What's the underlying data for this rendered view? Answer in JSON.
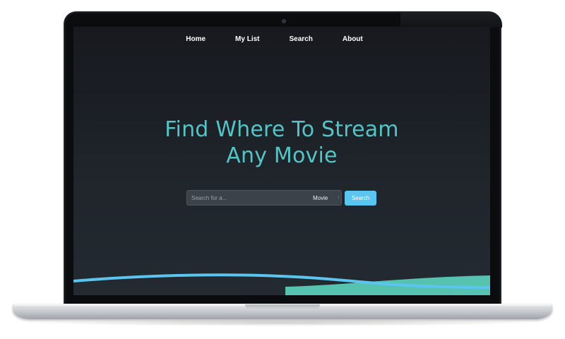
{
  "nav": {
    "items": [
      {
        "label": "Home"
      },
      {
        "label": "My List"
      },
      {
        "label": "Search"
      },
      {
        "label": "About"
      }
    ]
  },
  "hero": {
    "title_line1": "Find Where To Stream",
    "title_line2": "Any Movie"
  },
  "search": {
    "placeholder": "Search for a...",
    "type_selected": "Movie",
    "button_label": "Search"
  },
  "colors": {
    "accent_title": "#56c3c7",
    "button_blue": "#5bc4ef",
    "wave_blue": "#5bc4ef",
    "wave_teal": "#56c3b0",
    "background_dark": "#1f252b"
  },
  "icons": {
    "select_chevron": "chevron-updown-icon",
    "camera": "camera-icon"
  }
}
